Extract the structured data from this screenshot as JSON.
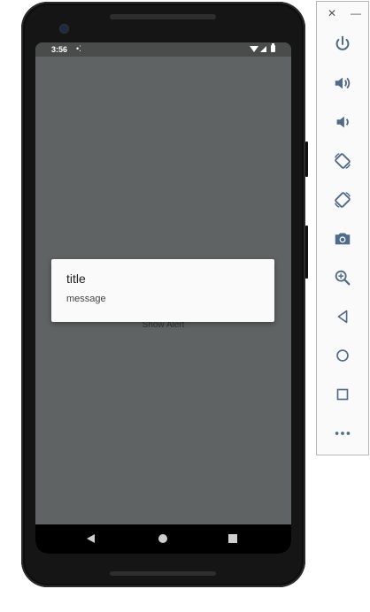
{
  "status_bar": {
    "time": "3:56",
    "notification_icon": "settings-dots-icon",
    "status_icons": [
      "wifi-icon",
      "signal-icon",
      "battery-icon"
    ]
  },
  "dialog": {
    "title": "title",
    "message": "message"
  },
  "app": {
    "show_alert_label": "Show Alert"
  },
  "nav_bar": {
    "buttons": [
      "back",
      "home",
      "recents"
    ]
  },
  "toolbar": {
    "window_controls": [
      "close",
      "minimize"
    ],
    "close_glyph": "✕",
    "minimize_glyph": "—",
    "buttons": [
      {
        "name": "power",
        "icon": "power-icon"
      },
      {
        "name": "volume-up",
        "icon": "volume-up-icon"
      },
      {
        "name": "volume-down",
        "icon": "volume-down-icon"
      },
      {
        "name": "rotate-left",
        "icon": "rotate-left-icon"
      },
      {
        "name": "rotate-right",
        "icon": "rotate-right-icon"
      },
      {
        "name": "screenshot",
        "icon": "camera-icon"
      },
      {
        "name": "zoom",
        "icon": "zoom-in-icon"
      },
      {
        "name": "back",
        "icon": "back-triangle-icon"
      },
      {
        "name": "home",
        "icon": "home-circle-icon"
      },
      {
        "name": "overview",
        "icon": "overview-square-icon"
      },
      {
        "name": "more",
        "icon": "more-dots-icon"
      }
    ]
  },
  "colors": {
    "screen_background": "#5f6363",
    "toolbar_icon": "#4f6a8a",
    "dialog_background": "#fafafa"
  }
}
